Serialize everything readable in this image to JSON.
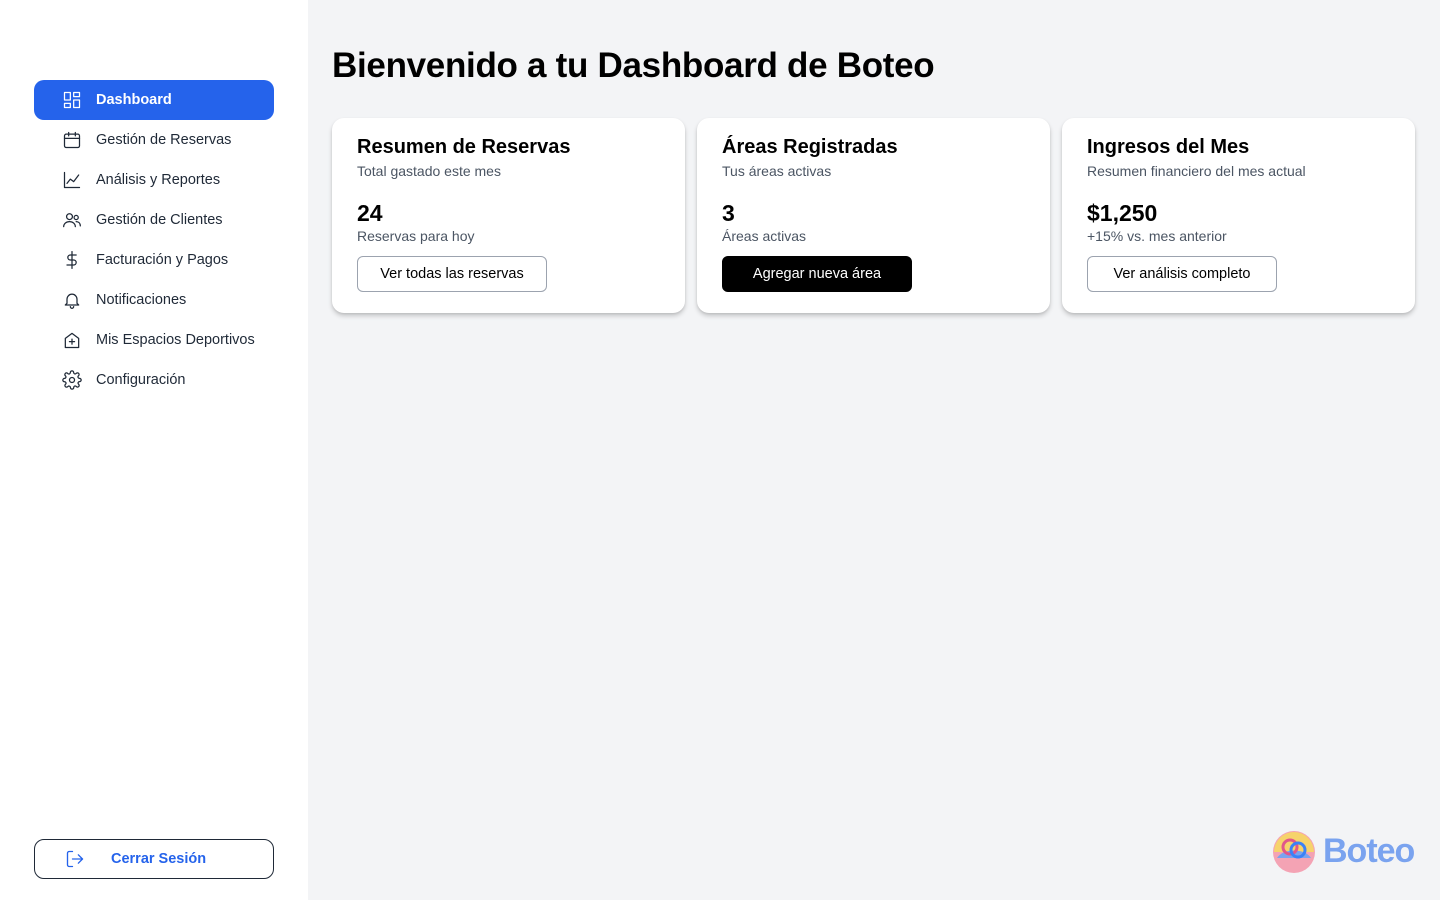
{
  "sidebar": {
    "items": [
      {
        "label": "Dashboard",
        "icon": "dashboard-grid-icon",
        "active": true
      },
      {
        "label": "Gestión de Reservas",
        "icon": "calendar-icon"
      },
      {
        "label": "Análisis y Reportes",
        "icon": "chart-line-icon"
      },
      {
        "label": "Gestión de Clientes",
        "icon": "users-icon"
      },
      {
        "label": "Facturación y Pagos",
        "icon": "dollar-icon"
      },
      {
        "label": "Notificaciones",
        "icon": "bell-icon"
      },
      {
        "label": "Mis Espacios Deportivos",
        "icon": "home-plus-icon"
      },
      {
        "label": "Configuración",
        "icon": "gear-icon"
      }
    ],
    "logout_label": "Cerrar Sesión"
  },
  "main": {
    "title": "Bienvenido a tu Dashboard de Boteo",
    "cards": [
      {
        "title": "Resumen de Reservas",
        "subtitle": "Total gastado este mes",
        "value": "24",
        "caption": "Reservas para hoy",
        "button": "Ver todas las reservas"
      },
      {
        "title": "Áreas Registradas",
        "subtitle": "Tus áreas activas",
        "value": "3",
        "caption": "Áreas activas",
        "button": "Agregar nueva área"
      },
      {
        "title": "Ingresos del Mes",
        "subtitle": "Resumen financiero del mes actual",
        "value": "$1,250",
        "caption": "+15% vs. mes anterior",
        "button": "Ver análisis completo"
      }
    ]
  },
  "brand": {
    "name": "Boteo"
  },
  "colors": {
    "accent": "#2563eb",
    "page_bg": "#f3f4f6",
    "brand_text": "#7aa3ef"
  }
}
